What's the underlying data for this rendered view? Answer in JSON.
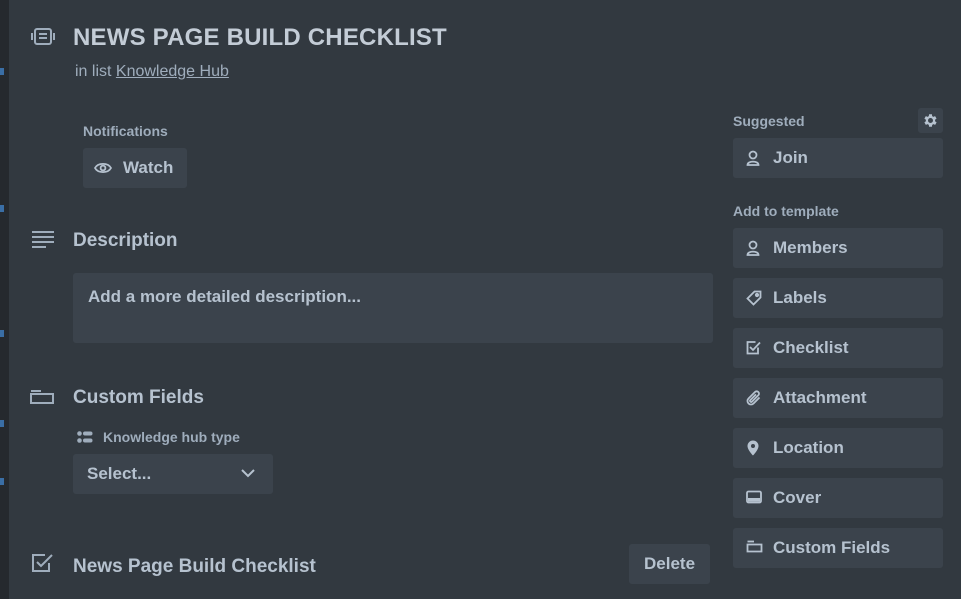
{
  "card": {
    "title": "NEWS PAGE BUILD CHECKLIST",
    "in_list_prefix": "in list",
    "list_name": "Knowledge Hub"
  },
  "notifications": {
    "label": "Notifications",
    "watch_label": "Watch"
  },
  "description": {
    "heading": "Description",
    "placeholder": "Add a more detailed description..."
  },
  "custom_fields": {
    "heading": "Custom Fields",
    "field_label": "Knowledge hub type",
    "select_value": "Select..."
  },
  "checklist": {
    "title": "News Page Build Checklist",
    "delete_label": "Delete"
  },
  "sidebar": {
    "suggested_label": "Suggested",
    "join_label": "Join",
    "add_to_template_label": "Add to template",
    "items": [
      {
        "label": "Members",
        "icon": "person-icon"
      },
      {
        "label": "Labels",
        "icon": "tag-icon"
      },
      {
        "label": "Checklist",
        "icon": "checkbox-icon"
      },
      {
        "label": "Attachment",
        "icon": "paperclip-icon"
      },
      {
        "label": "Location",
        "icon": "location-pin-icon"
      },
      {
        "label": "Cover",
        "icon": "cover-icon"
      },
      {
        "label": "Custom Fields",
        "icon": "custom-fields-icon"
      }
    ]
  }
}
